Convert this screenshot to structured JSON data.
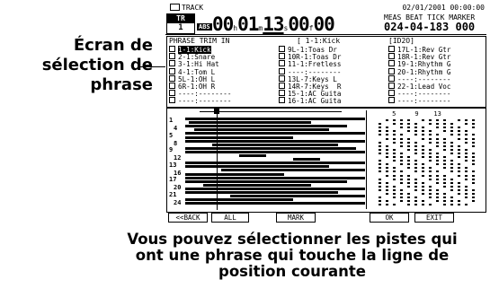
{
  "callout": {
    "lines": [
      "Écran de",
      "sélection de",
      "phrase"
    ]
  },
  "header": {
    "track_label": "TRACK",
    "datetime": "02/01/2001 00:00:00",
    "track_badge": {
      "label": "TR",
      "number": "1"
    },
    "abs_label": "ABS",
    "time": {
      "h": "00",
      "h_unit": "h",
      "m": "01",
      "m_unit": "m",
      "s": "13",
      "s_unit": "s",
      "frames": "00",
      "f_unit": "f",
      "sub": "00"
    },
    "mbt_headers": "MEAS BEAT TICK MARKER",
    "mbt_value": "024-04-183 000"
  },
  "phrase_trim": {
    "title": "PHRASE TRIM IN",
    "col2_title": "[ 1-1:Kick",
    "col3_title": "[ID2O]",
    "columns": [
      [
        {
          "text": "1-1:Kick",
          "selected": true
        },
        {
          "text": "2-1:Snare",
          "selected": false
        },
        {
          "text": "3-1:Hi Hat",
          "selected": false
        },
        {
          "text": "4-1:Tom L",
          "selected": false
        },
        {
          "text": "5L-1:OH L",
          "selected": false
        },
        {
          "text": "6R-1:OH R",
          "selected": false
        },
        {
          "text": "----:--------",
          "selected": false
        },
        {
          "text": "----:--------",
          "selected": false
        }
      ],
      [
        {
          "text": "9L-1:Toas Dr",
          "selected": false
        },
        {
          "text": "10R-1:Toas Dr",
          "selected": false
        },
        {
          "text": "11-1:Fretless",
          "selected": false
        },
        {
          "text": "----:--------",
          "selected": false
        },
        {
          "text": "13L-7:Keys L",
          "selected": false
        },
        {
          "text": "14R-7:Keys  R",
          "selected": false
        },
        {
          "text": "15-1:AC Guita",
          "selected": false
        },
        {
          "text": "16-1:AC Guita",
          "selected": false
        }
      ],
      [
        {
          "text": "17L-1:Rev Gtr",
          "selected": false
        },
        {
          "text": "18R-1:Rev Gtr",
          "selected": false
        },
        {
          "text": "19-1:Rhythm G",
          "selected": false
        },
        {
          "text": "20-1:Rhythm G",
          "selected": false
        },
        {
          "text": "----:--------",
          "selected": false
        },
        {
          "text": "22-1:Lead Voc",
          "selected": false
        },
        {
          "text": "----:--------",
          "selected": false
        },
        {
          "text": "----:--------",
          "selected": false
        }
      ]
    ]
  },
  "arrange": {
    "track_numbers": [
      "1",
      "4",
      "5",
      "8",
      "9",
      "12",
      "13",
      "16",
      "17",
      "20",
      "21",
      "24"
    ],
    "meter_header": "     5     9    13"
  },
  "softkeys": [
    "<<BACK",
    "ALL",
    "MARK",
    "OK",
    "EXIT"
  ],
  "caption": {
    "lines": [
      "Vous pouvez sélectionner les pistes qui",
      "ont une phrase qui touche la ligne de",
      "position courante"
    ]
  }
}
